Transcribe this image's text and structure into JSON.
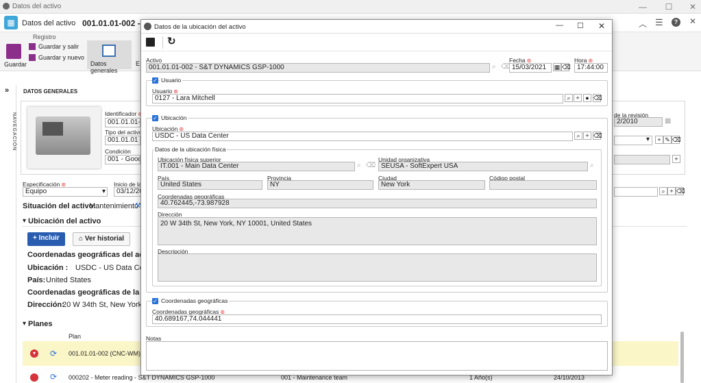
{
  "os": {
    "title": "Datos del activo"
  },
  "header": {
    "crumb1": "Datos del activo",
    "crumb2": "001.01.01-002 -"
  },
  "ribbon": {
    "group": "Registro",
    "save": "Guardar",
    "save_exit": "Guardar y salir",
    "save_new": "Guardar y nuevo",
    "general": "Datos generales",
    "cut": "E"
  },
  "nav": {
    "label": "NAVEGACIÓN"
  },
  "section": {
    "title": "DATOS GENERALES"
  },
  "form": {
    "identificador_label": "Identificador",
    "identificador": "001.01.01-0",
    "tipo_label": "Tipo del activo",
    "tipo": "001.01.01 -",
    "condicion_label": "Condición",
    "condicion": "001 - Good",
    "revision_label": "de la revisión",
    "revision": "2/2010",
    "especificacion_label": "Especificación",
    "especificacion": "Equipo",
    "inicio_label": "Inicio de la",
    "inicio": "03/12/20",
    "situacion_label": "Situación del activo:",
    "situacion": "Mantenimiento"
  },
  "ubic": {
    "title": "Ubicación del activo",
    "incluir": "Incluir",
    "historial": "Ver historial",
    "coord_title": "Coordenadas geográficas del activo",
    "ubic_label": "Ubicación :",
    "ubic_val": "USDC - US Data Center",
    "pais_label": "País:",
    "pais_val": "United States",
    "coord2_title": "Coordenadas geográficas de la ubic",
    "dir_label": "Dirección:",
    "dir_val": "20 W 34th St, New York, NY 1000"
  },
  "planes": {
    "title": "Planes",
    "col_plan": "Plan",
    "rows": [
      {
        "plan": "001.01.01-002 (CNC-WM) -"
      },
      {
        "plan": "000202 - Meter reading - S&T DYNAMICS GSP-1000",
        "team": "001 - Maintenance team",
        "freq": "1 Año(s)",
        "date": "24/10/2013"
      }
    ]
  },
  "modal": {
    "title": "Datos de la ubicación del activo",
    "activo_label": "Activo",
    "activo": "001.01.01-002 - S&T DYNAMICS GSP-1000",
    "fecha_label": "Fecha",
    "fecha": "15/03/2021",
    "hora_label": "Hora",
    "hora": "17:44:00",
    "usuario_group": "Usuario",
    "usuario_label": "Usuario",
    "usuario": "0127 - Lara Mitchell",
    "ubicacion_group": "Ubicación",
    "ubicacion_label": "Ubicación",
    "ubicacion": "USDC - US Data Center",
    "fisica_group": "Datos de la ubicación física",
    "superior_label": "Ubicación física superior",
    "superior": "IT.001 - Main Data Center",
    "unidad_label": "Unidad organizativa",
    "unidad": "SEUSA - SoftExpert USA",
    "pais_label": "País",
    "pais": "United States",
    "provincia_label": "Provincia",
    "provincia": "NY",
    "ciudad_label": "Ciudad",
    "ciudad": "New York",
    "postal_label": "Código postal",
    "postal": "",
    "coords_label": "Coordenadas geográficas",
    "coords": "40.762445,-73.987928",
    "direccion_label": "Dirección",
    "direccion": "20 W 34th St, New York, NY 10001, United States",
    "descripcion_label": "Descripción",
    "descripcion": "",
    "geo_group": "Coordenadas geográficas",
    "geo_label": "Coordenadas geográficas",
    "geo": "40.689167,74.044441",
    "notas_label": "Notas",
    "notas": ""
  },
  "colors": {
    "accent": "#2a72d6",
    "brand": "#3ea6d8",
    "required": "#e03b3b",
    "highlight_row": "#fbf6c8",
    "incluir_btn": "#2a5db0"
  }
}
